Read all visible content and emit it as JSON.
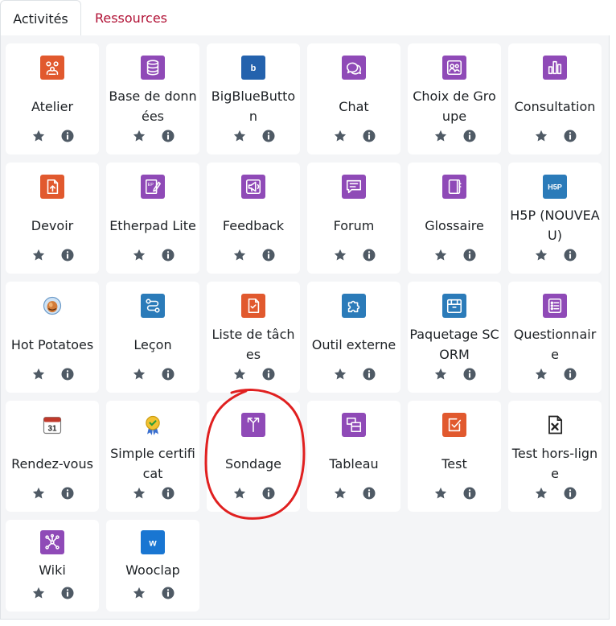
{
  "tabs": [
    {
      "label": "Activités",
      "active": true
    },
    {
      "label": "Ressources",
      "active": false
    }
  ],
  "colors": {
    "orange": "#e1592e",
    "purple": "#8f4ab7",
    "blue": "#2b7bb9",
    "tab_link": "#b11135",
    "action_icon": "#4f5a65",
    "annotation": "#e02020"
  },
  "activities": [
    {
      "label": "Atelier",
      "icon": "workshop-icon",
      "color": "#e1592e"
    },
    {
      "label": "Base de données",
      "icon": "database-icon",
      "color": "#8f4ab7"
    },
    {
      "label": "BigBlueButton",
      "icon": "bigbluebutton-icon",
      "color": "#2462ad"
    },
    {
      "label": "Chat",
      "icon": "chat-icon",
      "color": "#8f4ab7"
    },
    {
      "label": "Choix de Groupe",
      "icon": "group-choice-icon",
      "color": "#8f4ab7"
    },
    {
      "label": "Consultation",
      "icon": "poll-chart-icon",
      "color": "#8f4ab7"
    },
    {
      "label": "Devoir",
      "icon": "assignment-icon",
      "color": "#e1592e"
    },
    {
      "label": "Etherpad Lite",
      "icon": "etherpad-icon",
      "color": "#8f4ab7"
    },
    {
      "label": "Feedback",
      "icon": "megaphone-icon",
      "color": "#8f4ab7"
    },
    {
      "label": "Forum",
      "icon": "forum-icon",
      "color": "#8f4ab7"
    },
    {
      "label": "Glossaire",
      "icon": "glossary-book-icon",
      "color": "#8f4ab7"
    },
    {
      "label": "H5P (NOUVEAU)",
      "icon": "h5p-icon",
      "color": "#2b7bb9"
    },
    {
      "label": "Hot Potatoes",
      "icon": "hot-potatoes-icon",
      "color": ""
    },
    {
      "label": "Leçon",
      "icon": "lesson-path-icon",
      "color": "#2b7bb9"
    },
    {
      "label": "Liste de tâches",
      "icon": "checklist-icon",
      "color": "#e1592e"
    },
    {
      "label": "Outil externe",
      "icon": "puzzle-icon",
      "color": "#2b7bb9"
    },
    {
      "label": "Paquetage SCORM",
      "icon": "package-box-icon",
      "color": "#2b7bb9"
    },
    {
      "label": "Questionnaire",
      "icon": "questionnaire-list-icon",
      "color": "#8f4ab7"
    },
    {
      "label": "Rendez-vous",
      "icon": "calendar-icon",
      "color": ""
    },
    {
      "label": "Simple certificat",
      "icon": "certificate-ribbon-icon",
      "color": ""
    },
    {
      "label": "Sondage",
      "icon": "survey-signpost-icon",
      "color": "#8f4ab7"
    },
    {
      "label": "Tableau",
      "icon": "board-icon",
      "color": "#8f4ab7"
    },
    {
      "label": "Test",
      "icon": "quiz-check-icon",
      "color": "#e1592e"
    },
    {
      "label": "Test hors-ligne",
      "icon": "offline-quiz-icon",
      "color": ""
    },
    {
      "label": "Wiki",
      "icon": "wiki-network-icon",
      "color": "#8f4ab7"
    },
    {
      "label": "Wooclap",
      "icon": "wooclap-icon",
      "color": "#1976d2"
    }
  ]
}
